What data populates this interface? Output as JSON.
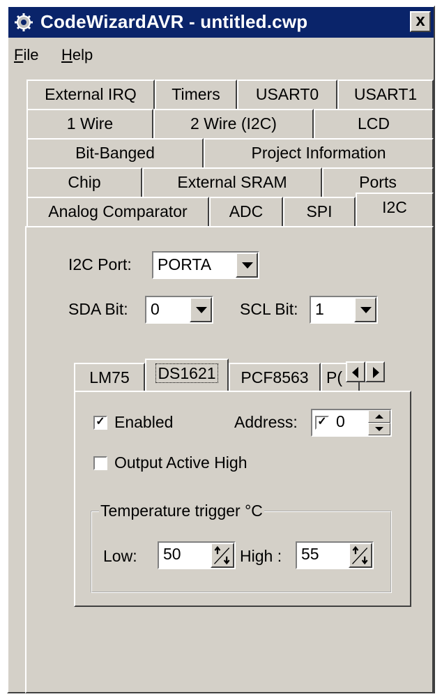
{
  "window": {
    "title": "CodeWizardAVR - untitled.cwp",
    "close_glyph": "x"
  },
  "menu": {
    "file_ul": "F",
    "file_rest": "ile",
    "help_ul": "H",
    "help_rest": "elp"
  },
  "tabs": {
    "row1": [
      "External IRQ",
      "Timers",
      "USART0",
      "USART1"
    ],
    "row2": [
      "1 Wire",
      "2 Wire (I2C)",
      "LCD"
    ],
    "row3": [
      "Bit-Banged",
      "Project Information"
    ],
    "row4": [
      "Chip",
      "External SRAM",
      "Ports"
    ],
    "row5": [
      "Analog Comparator",
      "ADC",
      "SPI",
      "I2C"
    ],
    "active": "I2C"
  },
  "i2c": {
    "port_label": "I2C Port:",
    "port_value": "PORTA",
    "sda_label": "SDA Bit:",
    "sda_value": "0",
    "scl_label": "SCL Bit:",
    "scl_value": "1"
  },
  "device_tabs": {
    "items": [
      "LM75",
      "DS1621",
      "PCF8563",
      "P("
    ],
    "active": "DS1621"
  },
  "ds1621": {
    "enabled_label": "Enabled",
    "enabled_checked": true,
    "address_label": "Address:",
    "address_check": "☑",
    "address_value": "0",
    "output_label": "Output Active High",
    "output_checked": false,
    "group_title": "Temperature trigger °C",
    "low_label": "Low:",
    "low_value": "50",
    "high_label": "High :",
    "high_value": "55"
  },
  "colors": {
    "titlebar": "#0a246a",
    "face": "#d4d0c8"
  }
}
